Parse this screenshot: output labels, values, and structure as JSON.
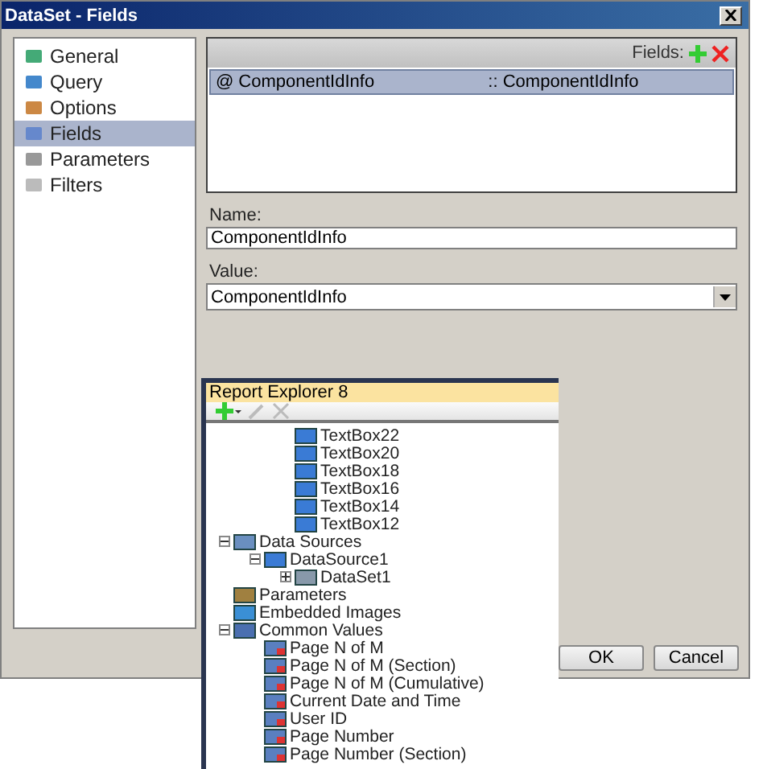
{
  "window": {
    "title": "DataSet - Fields"
  },
  "nav": {
    "items": [
      {
        "label": "General",
        "selected": false
      },
      {
        "label": "Query",
        "selected": false
      },
      {
        "label": "Options",
        "selected": false
      },
      {
        "label": "Fields",
        "selected": true
      },
      {
        "label": "Parameters",
        "selected": false
      },
      {
        "label": "Filters",
        "selected": false
      }
    ]
  },
  "fields": {
    "header": "Fields:",
    "rows": [
      {
        "marker": "@",
        "name": "ComponentIdInfo",
        "separator": "::",
        "value": "ComponentIdInfo",
        "selected": true
      }
    ]
  },
  "name_field": {
    "label": "Name:",
    "value": "ComponentIdInfo"
  },
  "value_field": {
    "label": "Value:",
    "value": "ComponentIdInfo"
  },
  "buttons": [
    "OK",
    "Cancel"
  ],
  "explorer": {
    "title": "Report Explorer 8",
    "tree": [
      {
        "children": [
          {
            "children": [
              {
                "label": "TextBox22",
                "kind": "textbox"
              },
              {
                "label": "TextBox20",
                "kind": "textbox"
              },
              {
                "label": "TextBox18",
                "kind": "textbox"
              },
              {
                "label": "TextBox16",
                "kind": "textbox"
              },
              {
                "label": "TextBox14",
                "kind": "textbox"
              },
              {
                "label": "TextBox12",
                "kind": "textbox"
              }
            ]
          }
        ]
      },
      {
        "label": "Data Sources",
        "kind": "datasources",
        "expanded": true,
        "children": [
          {
            "label": "DataSource1",
            "kind": "datasource",
            "expanded": true,
            "children": [
              {
                "label": "DataSet1",
                "kind": "dataset",
                "expanded": false
              }
            ]
          }
        ]
      },
      {
        "label": "Parameters",
        "kind": "parameters"
      },
      {
        "label": "Embedded Images",
        "kind": "images"
      },
      {
        "label": "Common Values",
        "kind": "values",
        "expanded": true,
        "children": [
          {
            "label": "Page N of M",
            "kind": "value"
          },
          {
            "label": "Page N of M (Section)",
            "kind": "value"
          },
          {
            "label": "Page N of M (Cumulative)",
            "kind": "value"
          },
          {
            "label": "Current Date and Time",
            "kind": "value"
          },
          {
            "label": "User ID",
            "kind": "value"
          },
          {
            "label": "Page Number",
            "kind": "value"
          },
          {
            "label": "Page Number (Section)",
            "kind": "value"
          }
        ]
      }
    ]
  }
}
